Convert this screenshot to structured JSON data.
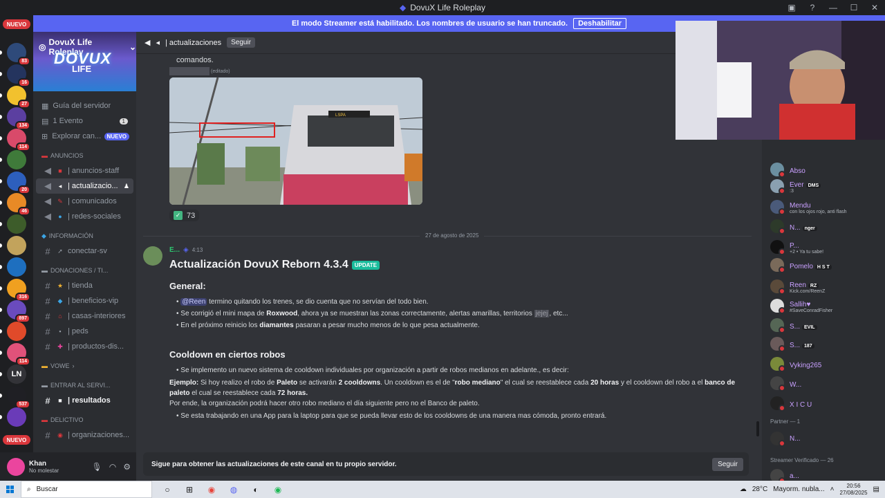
{
  "window": {
    "title": "DovuX Life Roleplay"
  },
  "banner": {
    "text": "El modo Streamer está habilitado. Los nombres de usuario se han truncado.",
    "button": "Deshabilitar"
  },
  "rail": {
    "new_top": "NUEVO",
    "new_bottom": "NUEVO",
    "servers": [
      {
        "color": "#2e4a7a",
        "badge": "83"
      },
      {
        "color": "#24345e",
        "badge": "16"
      },
      {
        "color": "#f2c12e",
        "badge": "27"
      },
      {
        "color": "#5b3fa0",
        "badge": "134"
      },
      {
        "color": "#d94a6a",
        "badge": "114"
      },
      {
        "color": "#3f7a3a",
        "badge": ""
      },
      {
        "color": "#2d5fbd",
        "badge": "20"
      },
      {
        "color": "#e88a26",
        "badge": "46"
      },
      {
        "color": "#3d5c2a",
        "badge": ""
      },
      {
        "color": "#c2a35c",
        "badge": ""
      },
      {
        "color": "#1e6fbf",
        "badge": ""
      },
      {
        "color": "#f0a020",
        "badge": "316"
      },
      {
        "color": "#6a4bbd",
        "badge": "897"
      },
      {
        "color": "#e04a2a",
        "badge": ""
      },
      {
        "color": "#e0527a",
        "badge": "114"
      },
      {
        "color": "#333338",
        "badge": "",
        "text": "LN"
      },
      {
        "color": "#1f1f24",
        "badge": "537"
      },
      {
        "color": "#6a3bb8",
        "badge": ""
      }
    ]
  },
  "sidebar": {
    "server_name": "DovuX Life Roleplay",
    "logo_line1": "DOVUX",
    "logo_line2": "LIFE",
    "nav": [
      {
        "label": "Guía del servidor"
      },
      {
        "label": "1 Evento",
        "count": "1"
      },
      {
        "label": "Explorar can...",
        "badge": "NUEVO"
      }
    ],
    "categories": {
      "anuncios": "ANUNCIOS",
      "informacion": "INFORMACIÓN",
      "donaciones": "DONACIONES / TI...",
      "vowe": "VOWE",
      "entrar": "ENTRAR AL SERVI...",
      "delictivo": "DELICTIVO"
    },
    "channels": {
      "anuncios_staff": "| anuncios-staff",
      "actualizaciones": "| actualizacio...",
      "comunicados": "| comunicados",
      "redes_sociales": "| redes-sociales",
      "conectar": "conectar-sv",
      "tienda": "| tienda",
      "beneficios": "| beneficios-vip",
      "casas": "| casas-interiores",
      "peds": "| peds",
      "productos": "| productos-dis...",
      "resultados": "| resultados",
      "organizaciones": "| organizaciones..."
    }
  },
  "user": {
    "name": "Khan",
    "status": "No molestar"
  },
  "main": {
    "channel_name": "| actualizaciones",
    "follow_label": "Seguir",
    "prev_text": "comandos.",
    "edited": "(editado)",
    "sign_text": "LSPA",
    "reaction_count": "73",
    "date_divider": "27 de agosto de 2025",
    "message": {
      "author": "E...",
      "time": "4:13",
      "title": "Actualización DovuX Reborn 4.3.4",
      "badge": "UPDATE",
      "general_heading": "General:",
      "b1_mention": "@Reen",
      "b1_text": " termino quitando los trenes, se dio cuenta que no servían del todo bien.",
      "b2_pre": "Se corrigió el mini mapa de ",
      "b2_bold": "Roxwood",
      "b2_mid": ", ahora ya se muestran las zonas correctamente, alertas amarillas, territorios ",
      "b2_spoiler": "jejej",
      "b2_end": ", etc...",
      "b3_pre": "En el próximo reinicio los ",
      "b3_bold": "diamantes",
      "b3_end": " pasaran a pesar mucho menos de lo que pesa actualmente.",
      "cooldown_heading": "Cooldown en ciertos robos",
      "c1": "Se implemento un nuevo sistema de cooldown individuales por organización a partir de robos medianos en adelante., es decir:",
      "ej_label": "Ejemplo:",
      "ej_1": " Si hoy realizo el robo de ",
      "ej_paleto": "Paleto",
      "ej_2": " se activarán ",
      "ej_2cd": "2 cooldowns",
      "ej_3": ". Un cooldown es el de \"",
      "ej_robo": "robo mediano",
      "ej_4": "\" el cual se reestablece cada ",
      "ej_20": "20 horas",
      "ej_5": " y el cooldown del robo a el ",
      "ej_banco": "banco de paleto",
      "ej_6": " el cual se reestablece cada ",
      "ej_72": "72 horas.",
      "porende": "Por ende, la organización podrá hacer otro robo mediano el día siguiente pero no el Banco de paleto.",
      "c2": "Se esta trabajando en una App para la laptop para que se pueda llevar esto de los cooldowns de una manera mas cómoda, pronto entrará."
    },
    "bottom_text": "Sigue para obtener las actualizaciones de este canal en tu propio servidor.",
    "bottom_button": "Seguir"
  },
  "members": {
    "list": [
      {
        "name": "Abso",
        "sub": "",
        "tag": "",
        "color": "#6b8fa0"
      },
      {
        "name": "Ever",
        "sub": ":3",
        "tag": "DMS",
        "color": "#8aa0b0"
      },
      {
        "name": "Mendu",
        "sub": "con los ojos rojo, anti flash",
        "tag": "",
        "color": "#4a5a7a"
      },
      {
        "name": "N...",
        "sub": "",
        "tag": "nger",
        "color": "#2d3a2a"
      },
      {
        "name": "P...",
        "sub": "+2 • Ya tu sabe!",
        "tag": "",
        "color": "#111111"
      },
      {
        "name": "Pomelo",
        "sub": "",
        "tag": "H S T",
        "color": "#7a6a5a"
      },
      {
        "name": "Reen",
        "sub": "Kick.com/ReenZ",
        "tag": "RZ",
        "color": "#5a4a3a"
      },
      {
        "name": "Sallih♥",
        "sub": "#SaveConradFisher",
        "tag": "",
        "color": "#ddd"
      },
      {
        "name": "S...",
        "sub": "",
        "tag": "EVIL",
        "color": "#556655"
      },
      {
        "name": "S...",
        "sub": "",
        "tag": "187",
        "color": "#6a5a5a"
      },
      {
        "name": "Vyking265",
        "sub": "",
        "tag": "",
        "color": "#7a8a3a"
      },
      {
        "name": "W...",
        "sub": "",
        "tag": "",
        "color": "#444"
      },
      {
        "name": "X I C U",
        "sub": "",
        "tag": "",
        "color": "#222"
      }
    ],
    "partner_section": "Partner — 1",
    "partner": {
      "name": "N...",
      "color": "#333"
    },
    "streamer_section": "Streamer Verificado — 26",
    "streamer": {
      "name": "a...",
      "color": "#444"
    }
  },
  "taskbar": {
    "search": "Buscar",
    "temp": "28°C",
    "weather": "Mayorm. nubla...",
    "time": "20:56",
    "date": "27/08/2025"
  }
}
